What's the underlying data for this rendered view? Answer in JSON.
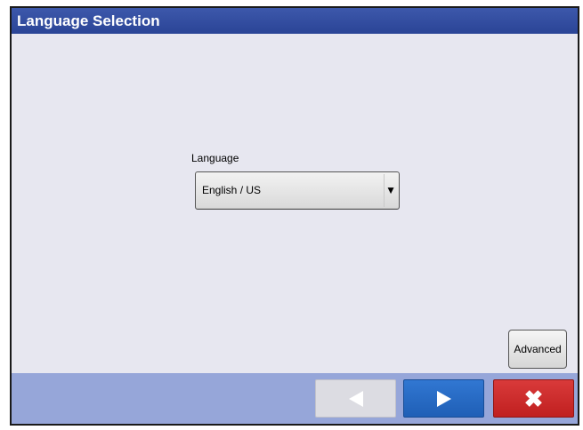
{
  "window": {
    "title": "Language Selection"
  },
  "language": {
    "label": "Language",
    "selected": "English / US",
    "dropdown_icon": "triangle-down"
  },
  "advanced": {
    "label": "Advanced"
  },
  "footer": {
    "back_icon": "left-arrow",
    "next_icon": "right-arrow",
    "cancel_icon": "x-mark",
    "cancel_glyph": "✖"
  },
  "colors": {
    "title_bar": "#2e4a9e",
    "background": "#e7e7f0",
    "footer": "#96a6d9",
    "next_button": "#2a6cc7",
    "cancel_button": "#d12b2b",
    "back_button_disabled": "#dcdce2"
  }
}
